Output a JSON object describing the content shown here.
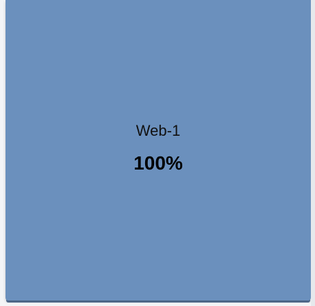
{
  "tile": {
    "name": "Web-1",
    "value": "100%",
    "percent": 100,
    "background_color": "#6b90bd"
  }
}
